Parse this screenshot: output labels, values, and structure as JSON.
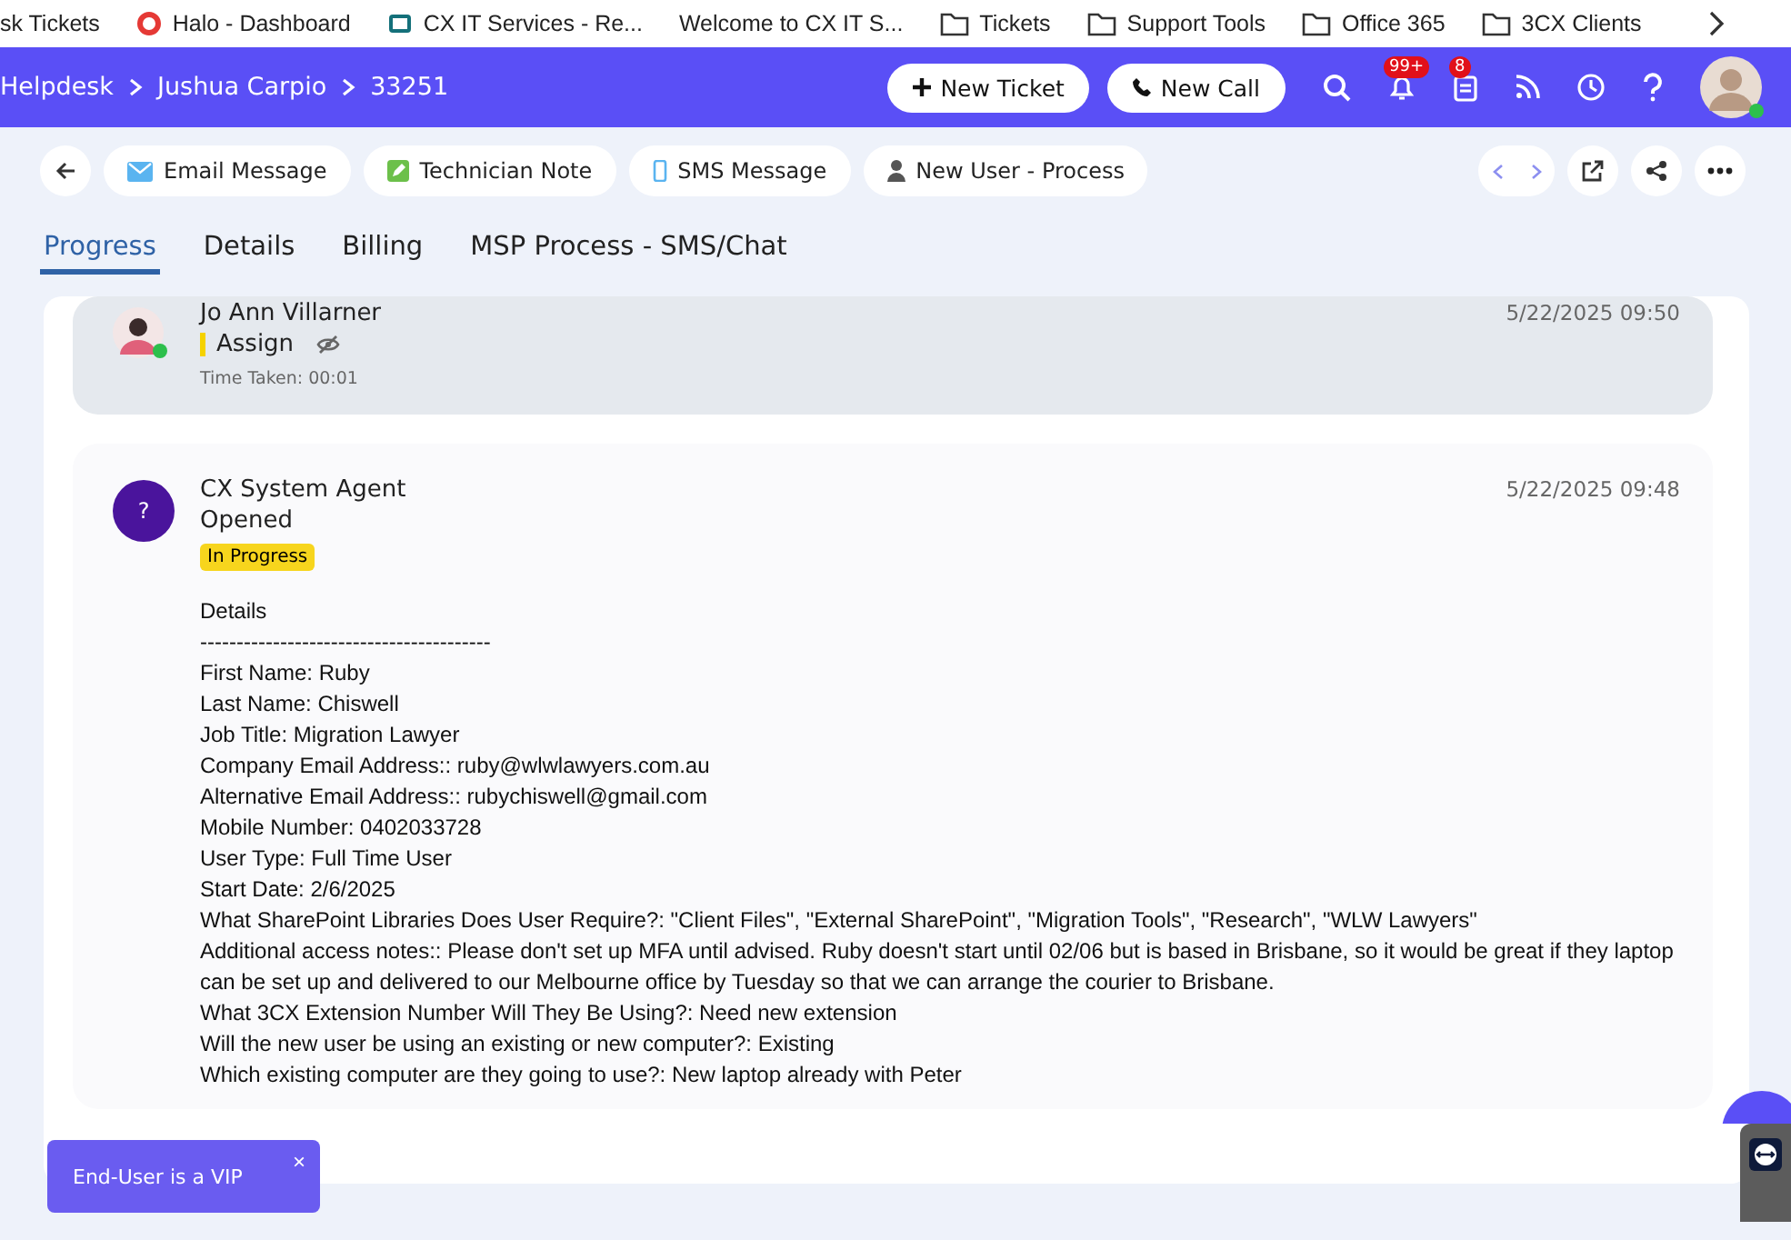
{
  "bookmarks": [
    {
      "label": "sk Tickets",
      "kind": "none"
    },
    {
      "label": "Halo - Dashboard",
      "kind": "ring"
    },
    {
      "label": "CX IT Services - Re...",
      "kind": "app"
    },
    {
      "label": "Welcome to CX IT S...",
      "kind": "none"
    },
    {
      "label": "Tickets",
      "kind": "folder"
    },
    {
      "label": "Support Tools",
      "kind": "folder"
    },
    {
      "label": "Office 365",
      "kind": "folder"
    },
    {
      "label": "3CX Clients",
      "kind": "folder"
    }
  ],
  "breadcrumb": [
    "Helpdesk",
    "Jushua Carpio",
    "33251"
  ],
  "header_buttons": [
    {
      "label": "New Ticket",
      "kind": "plus"
    },
    {
      "label": "New Call",
      "kind": "phone"
    }
  ],
  "header_icons": [
    {
      "kind": "search"
    },
    {
      "kind": "bell",
      "badge": "99+"
    },
    {
      "kind": "clipboard",
      "badge": "8"
    },
    {
      "kind": "feed"
    },
    {
      "kind": "clock"
    },
    {
      "kind": "help"
    }
  ],
  "actions": [
    {
      "label": "Email Message",
      "kind": "email"
    },
    {
      "label": "Technician Note",
      "kind": "note"
    },
    {
      "label": "SMS Message",
      "kind": "sms"
    },
    {
      "label": "New User - Process",
      "kind": "user"
    }
  ],
  "tabs": [
    {
      "label": "Progress",
      "selected": true
    },
    {
      "label": "Details",
      "selected": false
    },
    {
      "label": "Billing",
      "selected": false
    },
    {
      "label": "MSP Process - SMS/Chat",
      "selected": false
    }
  ],
  "entries": [
    {
      "author": "Jo Ann Villarner",
      "action": "Assign",
      "time": "5/22/2025 09:50",
      "hidden": true,
      "time_taken": "Time Taken: 00:01",
      "online": true,
      "shaded": true
    },
    {
      "author": "CX System Agent",
      "action": "Opened",
      "time": "5/22/2025 09:48",
      "hidden": false,
      "status": "In Progress",
      "avatar_letter": "?",
      "online": false,
      "shaded": false,
      "body": [
        "Details",
        "----------------------------------------",
        "First Name: Ruby",
        "Last Name: Chiswell",
        "Job Title: Migration Lawyer",
        "Company Email Address:: ruby@wlwlawyers.com.au",
        "Alternative Email Address:: rubychiswell@gmail.com",
        "Mobile Number: 0402033728",
        "User Type: Full Time User",
        "Start Date: 2/6/2025",
        "What SharePoint Libraries Does User Require?: \"Client Files\", \"External SharePoint\", \"Migration Tools\", \"Research\", \"WLW Lawyers\"",
        "Additional access notes:: Please don't set up MFA until advised. Ruby doesn't start until 02/06 but is based in Brisbane, so it would be great if they laptop can be set up and delivered to our Melbourne office by Tuesday so that we can arrange the courier to Brisbane.",
        "What 3CX Extension Number Will They Be Using?: Need new extension",
        "Will the new user be using an existing or new computer?: Existing",
        "Which existing computer are they going to use?: New laptop already with Peter"
      ]
    }
  ],
  "toast": {
    "label": "End-User is a VIP",
    "close": "×"
  }
}
